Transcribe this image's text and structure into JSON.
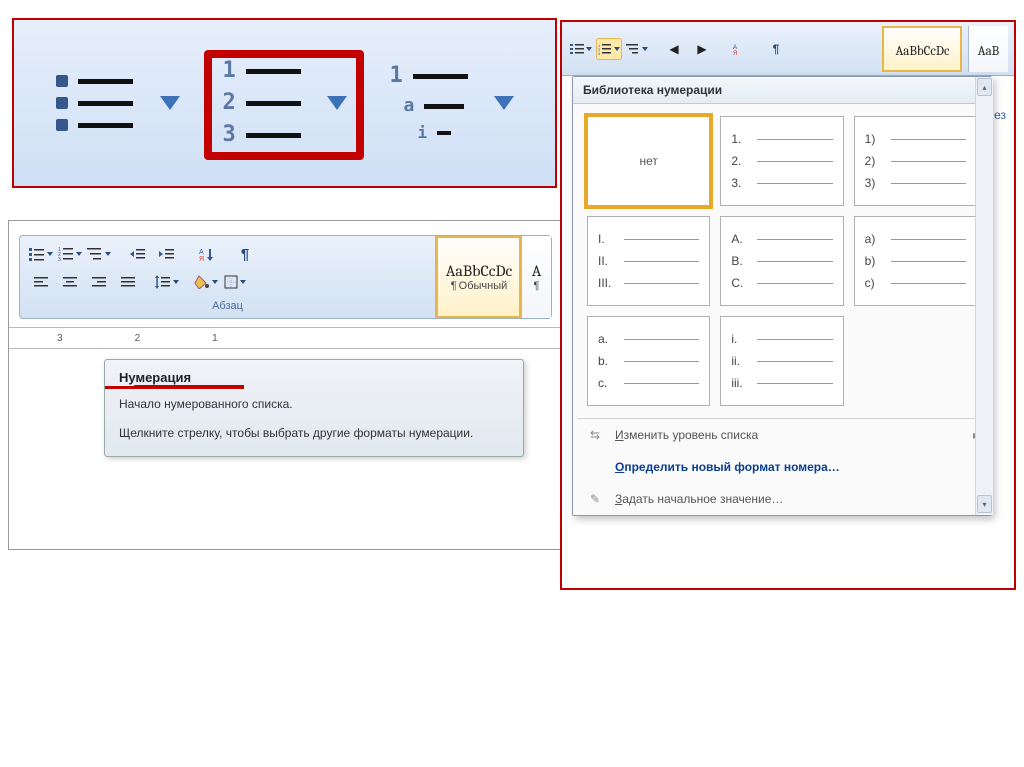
{
  "panel1": {
    "buttons": [
      "bullets",
      "numbering",
      "multilevel"
    ]
  },
  "ribbon": {
    "group_caption": "Абзац",
    "paragraph_mark": "¶",
    "style_preview": "AaBbCcDc",
    "style_name": "Обычный",
    "style_name_extra": "A"
  },
  "ruler": {
    "ticks": [
      "3",
      "2",
      "1"
    ]
  },
  "tooltip": {
    "title": "Нумерация",
    "line1": "Начало нумерованного списка.",
    "line2": "Щелкните стрелку, чтобы выбрать другие форматы нумерации."
  },
  "library": {
    "header": "Библиотека нумерации",
    "none": "нет",
    "swatches": [
      {
        "type": "none"
      },
      {
        "labels": [
          "1.",
          "2.",
          "3."
        ]
      },
      {
        "labels": [
          "1)",
          "2)",
          "3)"
        ]
      },
      {
        "labels": [
          "I.",
          "II.",
          "III."
        ]
      },
      {
        "labels": [
          "A.",
          "B.",
          "C."
        ]
      },
      {
        "labels": [
          "a)",
          "b)",
          "c)"
        ]
      },
      {
        "labels": [
          "a.",
          "b.",
          "c."
        ]
      },
      {
        "labels": [
          "i.",
          "ii.",
          "iii."
        ]
      }
    ],
    "opt_change_level": "Изменить уровень списка",
    "opt_define_new": "Определить новый формат номера…",
    "opt_set_start": "Задать начальное значение…",
    "truncated_text": "ез",
    "side_style_preview": "AaBbCcDc",
    "side_style_extra": "AaB"
  }
}
